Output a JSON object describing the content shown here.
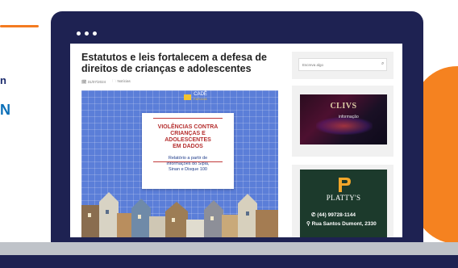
{
  "promo": {
    "accent_color": "#f47b20",
    "brand_navy": "#1e2252",
    "side_text_1": "n",
    "side_text_2": "N"
  },
  "window": {
    "dots": [
      "•",
      "•",
      "•"
    ]
  },
  "article": {
    "title": "Estatutos e leis fortalecem a defesa de direitos de crianças e adolescentes",
    "date": "31/07/2024",
    "category": "Notícias",
    "date_icon": "calendar-icon",
    "category_icon": "folder-icon"
  },
  "hero": {
    "logo_text": "CADÊ",
    "logo_sub": "PARANÁ",
    "heading": "VIOLÊNCIAS CONTRA\nCRIANÇAS E\nADOLESCENTES\nEM DADOS",
    "subtext": "Relatório a partir de\ninformações do Sipia,\nSinan e Disque 100",
    "background_color": "#5b7ed8",
    "heading_color": "#b52f2f"
  },
  "search": {
    "placeholder": "Escreva algo",
    "icon": "search-icon"
  },
  "ad1": {
    "title": "CLIVS",
    "subtitle": "informação"
  },
  "ad2": {
    "brand": "PLATTY'S",
    "tagline": "",
    "phone": "(44) 99728-1144",
    "address": "Rua Santos Dumont, 2330",
    "background_color": "#1c3a2c"
  }
}
